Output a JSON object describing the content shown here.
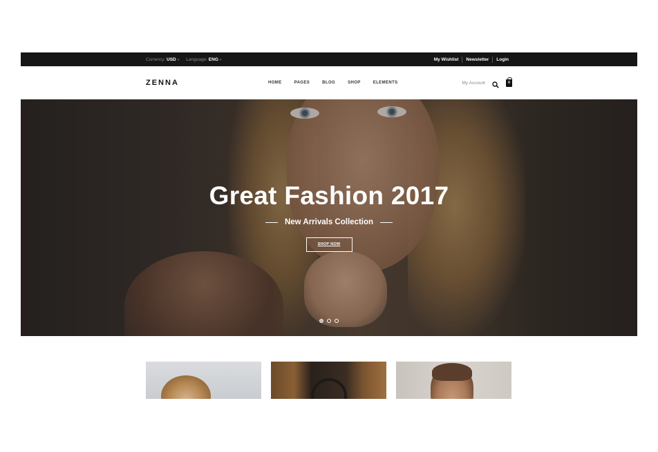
{
  "topbar": {
    "currency_label": "Currency:",
    "currency_value": "USD",
    "language_label": "Language:",
    "language_value": "ENG",
    "links": [
      "My Wishlist",
      "Newsletter",
      "Login"
    ]
  },
  "header": {
    "logo": "ZENNA",
    "nav": [
      "HOME",
      "PAGES",
      "BLOG",
      "SHOP",
      "ELEMENTS"
    ],
    "account": "My Account",
    "cart_count": "0"
  },
  "hero": {
    "title": "Great Fashion 2017",
    "subtitle": "New Arrivals Collection",
    "button": "SHOP NOW",
    "slides": 3,
    "active_slide": 1
  },
  "thumbnails": [
    "woman-portrait",
    "handbag",
    "man-portrait"
  ],
  "colors": {
    "topbar_bg": "#161616",
    "accent": "#ffffff"
  }
}
